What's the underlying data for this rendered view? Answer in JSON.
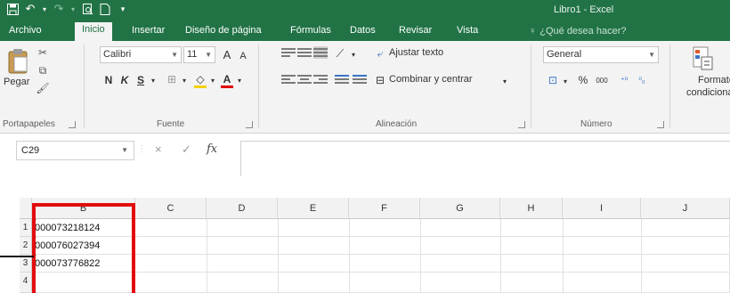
{
  "window": {
    "title": "Libro1 - Excel"
  },
  "qat": {
    "save_icon": "save-icon",
    "undo_icon": "undo-icon",
    "redo_icon": "redo-icon",
    "preview_icon": "print-preview-icon",
    "new_icon": "new-file-icon",
    "more_icon": "customize-qat-icon"
  },
  "tabs": [
    {
      "label": "Archivo"
    },
    {
      "label": "Inicio"
    },
    {
      "label": "Insertar"
    },
    {
      "label": "Diseño de página"
    },
    {
      "label": "Fórmulas"
    },
    {
      "label": "Datos"
    },
    {
      "label": "Revisar"
    },
    {
      "label": "Vista"
    }
  ],
  "tell_me": {
    "placeholder": "¿Qué desea hacer?"
  },
  "ribbon": {
    "clipboard": {
      "paste_label": "Pegar",
      "group_label": "Portapapeles"
    },
    "font": {
      "font_name": "Calibri",
      "font_size": "11",
      "bold": "N",
      "italic": "K",
      "underline": "S",
      "grow": "A",
      "shrink": "A",
      "fill_letter": "",
      "font_color_letter": "A",
      "group_label": "Fuente"
    },
    "alignment": {
      "wrap_label": "Ajustar texto",
      "merge_label": "Combinar y centrar",
      "group_label": "Alineación"
    },
    "number": {
      "format_value": "General",
      "percent": "%",
      "thousands": "000",
      "group_label": "Número"
    },
    "styles": {
      "cond_format_line1": "Formato",
      "cond_format_line2": "condicional"
    }
  },
  "formula_bar": {
    "name_box": "C29",
    "fx": "fx",
    "cancel": "×",
    "enter": "✓"
  },
  "grid": {
    "columns": [
      "B",
      "C",
      "D",
      "E",
      "F",
      "G",
      "H",
      "I",
      "J"
    ],
    "rows": [
      {
        "num": "1",
        "b": "000073218124"
      },
      {
        "num": "2",
        "b": "000076027394"
      },
      {
        "num": "3",
        "b": "000073776822"
      },
      {
        "num": "4",
        "b": ""
      }
    ]
  },
  "colors": {
    "excel_green": "#217346",
    "highlight_red": "#e20d0d",
    "error_triangle": "#1e8a3c"
  }
}
